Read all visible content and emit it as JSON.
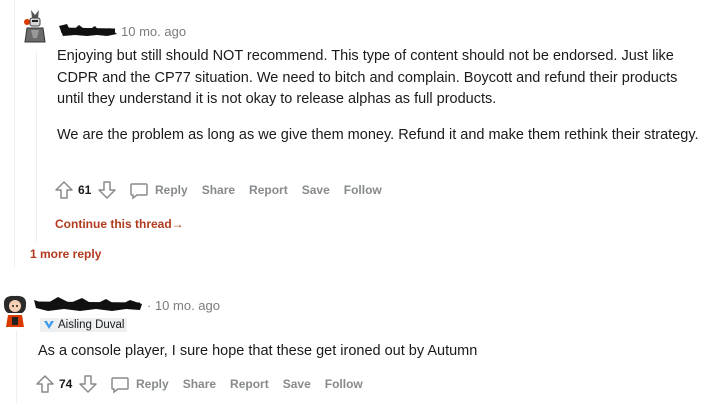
{
  "comment1": {
    "time": "10 mo. ago",
    "paragraphs": [
      "Enjoying but still should NOT recommend. This type of content should not be endorsed. Just like CDPR and the CP77 situation. We need to bitch and complain. Boycott and refund their products until they understand it is not okay to release alphas as full products.",
      "We are the problem as long as we give them money. Refund it and make them rethink their strategy."
    ],
    "votes": "61",
    "actions": {
      "reply": "Reply",
      "share": "Share",
      "report": "Report",
      "save": "Save",
      "follow": "Follow"
    },
    "continue_thread": "Continue this thread",
    "continue_arrow": "→"
  },
  "more_replies": "1 more reply",
  "comment2": {
    "time": "· 10 mo. ago",
    "flair": "Aisling Duval",
    "text": "As a console player, I sure hope that these get ironed out by Autumn",
    "votes": "74",
    "actions": {
      "reply": "Reply",
      "share": "Share",
      "report": "Report",
      "save": "Save",
      "follow": "Follow"
    }
  },
  "colors": {
    "link_red": "#b33a1e",
    "muted": "#878a8c",
    "text": "#1a1a1b",
    "thread_line": "#edeff1",
    "flair_bg": "#edeff1",
    "flair_icon": "#3d9be9"
  }
}
